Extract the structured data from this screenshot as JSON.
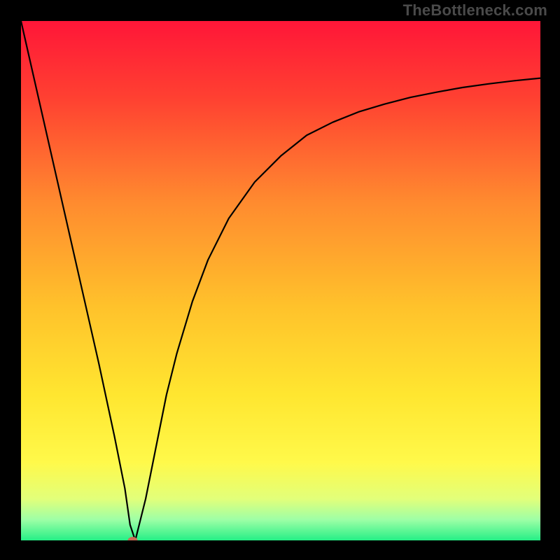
{
  "watermark": "TheBottleneck.com",
  "chart_data": {
    "type": "line",
    "title": "",
    "xlabel": "",
    "ylabel": "",
    "xlim": [
      0,
      100
    ],
    "ylim": [
      0,
      100
    ],
    "series": [
      {
        "name": "bottleneck-curve",
        "x": [
          0,
          5,
          10,
          15,
          18,
          20,
          21,
          22,
          24,
          26,
          28,
          30,
          33,
          36,
          40,
          45,
          50,
          55,
          60,
          65,
          70,
          75,
          80,
          85,
          90,
          95,
          100
        ],
        "values": [
          100,
          78,
          56,
          34,
          20,
          10,
          3,
          0,
          8,
          18,
          28,
          36,
          46,
          54,
          62,
          69,
          74,
          78,
          80.5,
          82.5,
          84,
          85.3,
          86.3,
          87.2,
          87.9,
          88.5,
          89
        ]
      }
    ],
    "background_gradient_stops": [
      {
        "offset": 0.0,
        "color": "#ff1638"
      },
      {
        "offset": 0.15,
        "color": "#ff4131"
      },
      {
        "offset": 0.35,
        "color": "#ff8b2f"
      },
      {
        "offset": 0.55,
        "color": "#ffc22b"
      },
      {
        "offset": 0.72,
        "color": "#ffe630"
      },
      {
        "offset": 0.85,
        "color": "#fff94a"
      },
      {
        "offset": 0.92,
        "color": "#e2ff7a"
      },
      {
        "offset": 0.96,
        "color": "#9effa6"
      },
      {
        "offset": 1.0,
        "color": "#25ef86"
      }
    ],
    "marker": {
      "x": 21.5,
      "y": 0,
      "color": "#c86b56",
      "rx": 7,
      "ry": 5
    }
  }
}
